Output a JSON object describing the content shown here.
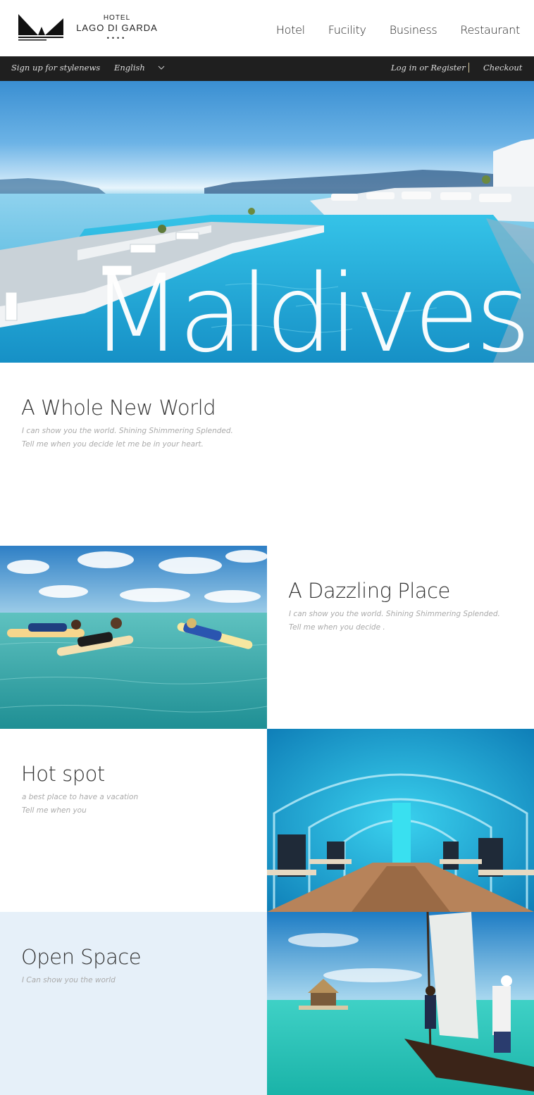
{
  "header": {
    "logo": {
      "hotel": "HOTEL",
      "name": "LAGO DI GARDA",
      "stars": "••••"
    },
    "nav": [
      "Hotel",
      "Fucility",
      "Business",
      "Restaurant"
    ]
  },
  "topbar": {
    "signup": "Sign up for stylenews",
    "language": "English",
    "login": "Log in or Register",
    "checkout": "Checkout"
  },
  "hero": {
    "word": "Maldives"
  },
  "intro": {
    "title": "A Whole New World",
    "line1": "I can show you the world. Shining Shimmering Splended.",
    "line2": "Tell me when you decide let me be in your heart."
  },
  "sections": [
    {
      "title": "A Dazzling Place",
      "line1": "I can show you the world. Shining Shimmering Splended.",
      "line2": "Tell me when you decide ."
    },
    {
      "title": "Hot spot",
      "line1": "a best place to have a vacation",
      "line2": "Tell me when you"
    },
    {
      "title": "Open Space",
      "line1": "I Can show you the world",
      "line2": ""
    }
  ],
  "colors": {
    "topbar": "#1f1f1f",
    "light_panel": "#e6f0f9",
    "separator": "#d7c9a0"
  }
}
